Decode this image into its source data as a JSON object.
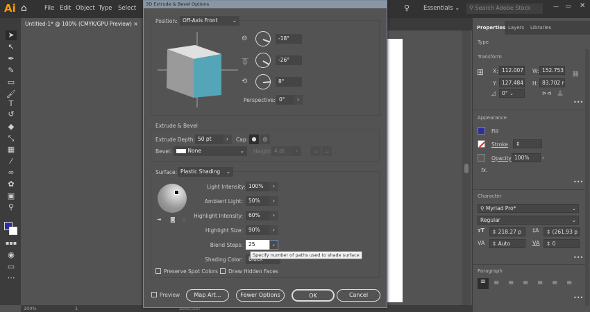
{
  "app": {
    "logo": "Ai",
    "menus": [
      "File",
      "Edit",
      "Object",
      "Type",
      "Select"
    ],
    "workspace": "Essentials",
    "search_placeholder": "Search Adobe Stock",
    "window_controls": [
      "minimize-icon",
      "restore-icon",
      "close-icon"
    ]
  },
  "document": {
    "tab_title": "Untitled-1* @ 100% (CMYK/GPU Preview)",
    "tab_close": "×"
  },
  "status_bar": {
    "zoom": "100%",
    "artboard": "1",
    "tool": "Selection"
  },
  "dialog": {
    "title": "3D Extrude & Bevel Options",
    "position_label": "Position:",
    "position_value": "Off-Axis Front",
    "rot_x": "-18°",
    "rot_y": "-26°",
    "rot_z": "8°",
    "perspective_label": "Perspective:",
    "perspective_value": "0°",
    "cube_front_color": "#55a5b8",
    "extrude_section": "Extrude & Bevel",
    "extrude_depth_label": "Extrude Depth:",
    "extrude_depth_value": "50 pt",
    "cap_label": "Cap:",
    "bevel_label": "Bevel:",
    "bevel_value": "None",
    "height_label": "Height:",
    "height_value": "4 pt",
    "surface_label": "Surface:",
    "surface_value": "Plastic Shading",
    "light_intensity_label": "Light Intensity:",
    "light_intensity_value": "100%",
    "ambient_light_label": "Ambient Light:",
    "ambient_light_value": "50%",
    "highlight_intensity_label": "Highlight Intensity:",
    "highlight_intensity_value": "60%",
    "highlight_size_label": "Highlight Size:",
    "highlight_size_value": "90%",
    "blend_steps_label": "Blend Steps:",
    "blend_steps_value": "25",
    "shading_color_label": "Shading Color:",
    "shading_color_value": "Black",
    "tooltip": "Specify number of paths used to shade surface",
    "preserve_spot": "Preserve Spot Colors",
    "draw_hidden": "Draw Hidden Faces",
    "preview": "Preview",
    "map_art": "Map Art...",
    "fewer_options": "Fewer Options",
    "ok": "OK",
    "cancel": "Cancel"
  },
  "panel": {
    "tabs": [
      "Properties",
      "Layers",
      "Libraries"
    ],
    "type_label": "Type",
    "transform_label": "Transform",
    "x_label": "X:",
    "x_value": "112.007 m",
    "y_label": "Y:",
    "y_value": "127.484 m",
    "w_label": "W:",
    "w_value": "152.753 m",
    "h_label": "H:",
    "h_value": "83.702 mm",
    "angle_value": "0°",
    "appearance_label": "Appearance",
    "fill_label": "Fill",
    "fill_color": "#2b2f9e",
    "stroke_label": "Stroke",
    "opacity_label": "Opacity",
    "opacity_value": "100%",
    "fx_label": "fx.",
    "character_label": "Character",
    "font_family": "Myriad Pro*",
    "font_style": "Regular",
    "font_size": "218.27 p",
    "leading": "(261.93 p",
    "kerning": "Auto",
    "tracking": "0",
    "paragraph_label": "Paragraph",
    "more": "•••"
  }
}
